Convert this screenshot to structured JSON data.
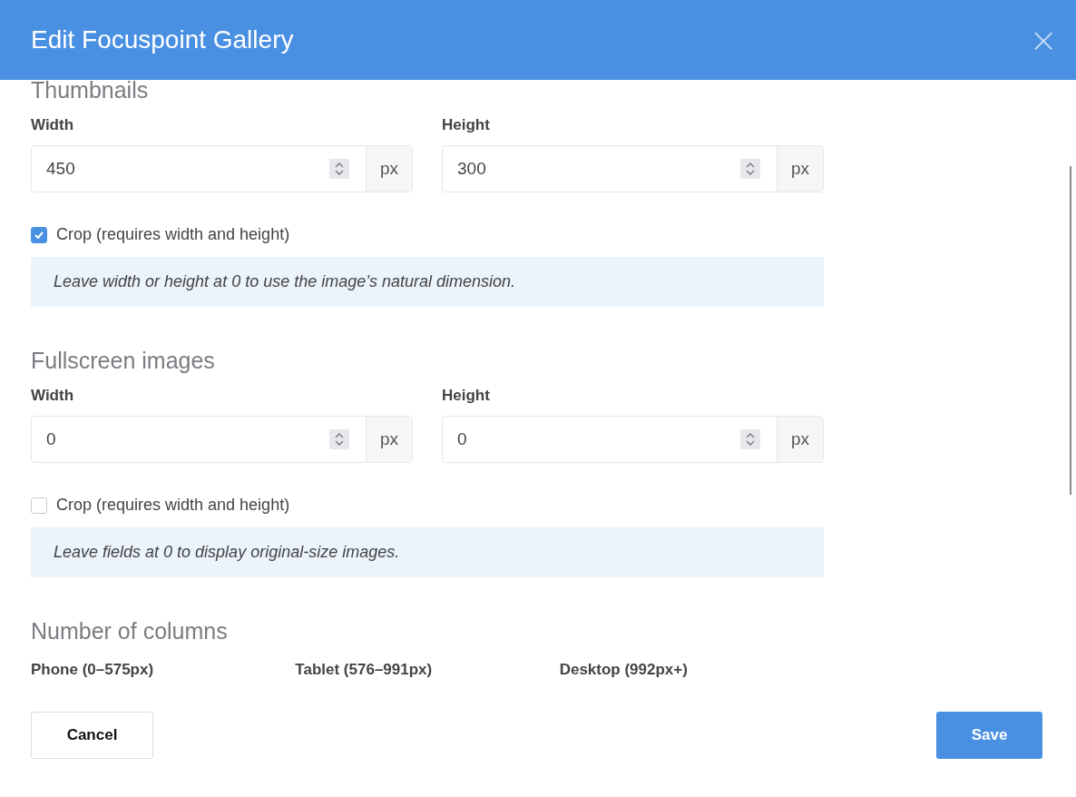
{
  "dialog": {
    "title": "Edit Focuspoint Gallery",
    "close": "×"
  },
  "sections": [
    {
      "heading": "Thumbnails",
      "fields": [
        {
          "label": "Width",
          "value": "450",
          "unit": "px"
        },
        {
          "label": "Height",
          "value": "300",
          "unit": "px"
        }
      ],
      "crop": {
        "label": "Crop (requires width and height)",
        "checked": true
      },
      "note": "Leave width or height at 0 to use the image’s natural dimension."
    },
    {
      "heading": "Fullscreen images",
      "fields": [
        {
          "label": "Width",
          "value": "0",
          "unit": "px"
        },
        {
          "label": "Height",
          "value": "0",
          "unit": "px"
        }
      ],
      "crop": {
        "label": "Crop (requires width and height)",
        "checked": false
      },
      "note": "Leave fields at 0 to display original-size images."
    }
  ],
  "columns": {
    "heading": "Number of columns",
    "labels": [
      "Phone (0–575px)",
      "Tablet (576–991px)",
      "Desktop (992px+)"
    ]
  },
  "buttons": {
    "cancel": "Cancel",
    "save": "Save"
  }
}
